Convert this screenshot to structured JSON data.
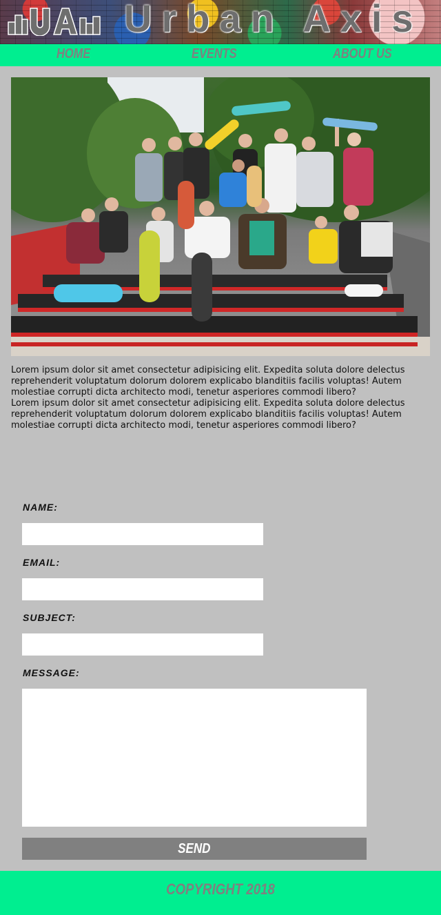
{
  "header": {
    "logo_text": "UA",
    "brand": "Urban Axis"
  },
  "nav": {
    "home": "Home",
    "events": "Events",
    "about": "About Us"
  },
  "hero": {
    "alt": "Group of skateboarders posing on skatepark steps"
  },
  "content": {
    "paragraph_1": "Lorem ipsum dolor sit amet consectetur adipisicing elit. Expedita soluta dolore delectus reprehenderit voluptatum dolorum dolorem explicabo blanditiis facilis voluptas! Autem molestiae corrupti dicta architecto modi, tenetur asperiores commodi libero?",
    "paragraph_2": "Lorem ipsum dolor sit amet consectetur adipisicing elit. Expedita soluta dolore delectus reprehenderit voluptatum dolorum dolorem explicabo blanditiis facilis voluptas! Autem molestiae corrupti dicta architecto modi, tenetur asperiores commodi libero?"
  },
  "form": {
    "name_label": "Name:",
    "name_value": "",
    "email_label": "Email:",
    "email_value": "",
    "subject_label": "Subject:",
    "subject_value": "",
    "message_label": "Message:",
    "message_value": "",
    "send_label": "Send"
  },
  "footer": {
    "copyright": "Copyright 2018"
  },
  "colors": {
    "page_background": "#c0c0c0",
    "accent_green": "#00ee90",
    "nav_text": "#808080",
    "button_gray": "#808080"
  }
}
